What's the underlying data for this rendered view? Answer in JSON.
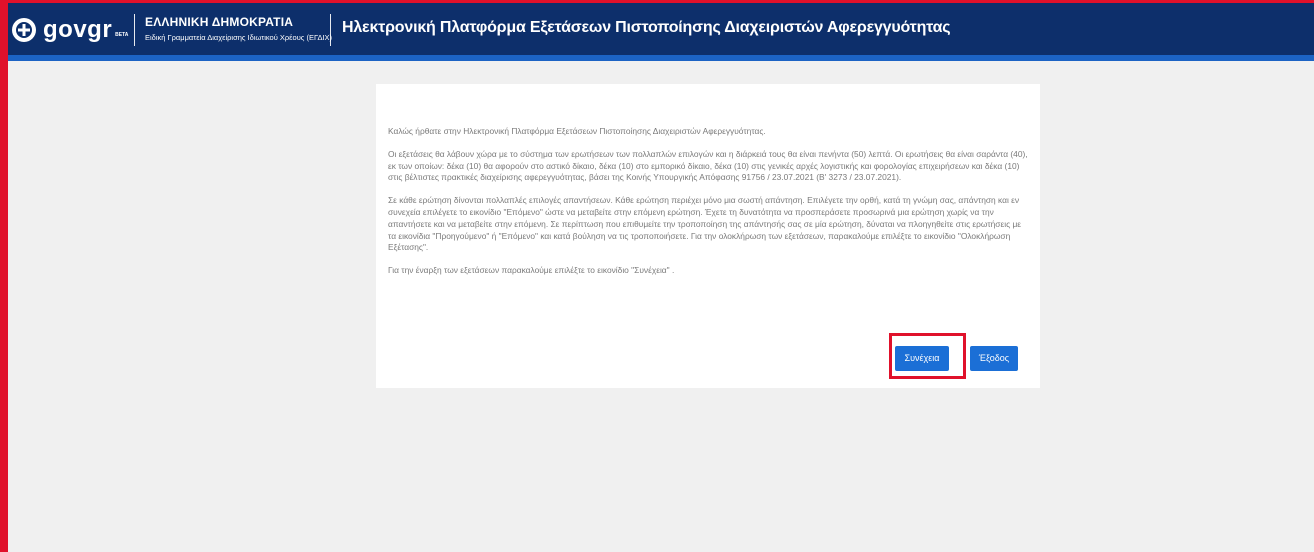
{
  "header": {
    "logo_text": "govgr",
    "logo_badge": "BETA",
    "gov_title": "ΕΛΛΗΝΙΚΗ ΔΗΜΟΚΡΑΤΙΑ",
    "gov_subtitle": "Ειδική Γραμματεία Διαχείρισης Ιδιωτικού Χρέους (ΕΓΔΙΧ)",
    "platform_title": "Ηλεκτρονική Πλατφόρμα Εξετάσεων Πιστοποίησης Διαχειριστών Αφερεγγυότητας",
    "colors": {
      "bar": "#0d2f6b",
      "accent": "#1c63c4"
    },
    "icons": {
      "emblem": "greek-emblem-icon"
    }
  },
  "content": {
    "welcome": "Καλώς ήρθατε στην Ηλεκτρονική Πλατφόρμα Εξετάσεων Πιστοποίησης Διαχειριστών Αφερεγγυότητας.",
    "exam_info": "Οι εξετάσεις θα λάβουν χώρα με το σύστημα των ερωτήσεων των πολλαπλών επιλογών και η διάρκειά τους θα είναι πενήντα (50) λεπτά. Οι ερωτήσεις θα είναι σαράντα (40), εκ των οποίων: δέκα (10) θα αφορούν στο αστικό δίκαιο, δέκα (10) στο εμπορικό δίκαιο, δέκα (10) στις γενικές αρχές λογιστικής και φορολογίας επιχειρήσεων και δέκα (10) στις βέλτιστες πρακτικές διαχείρισης αφερεγγυότητας, βάσει της Κοινής Υπουργικής Απόφασης 91756 / 23.07.2021 (Β' 3273 / 23.07.2021).",
    "instructions": "Σε κάθε ερώτηση δίνονται πολλαπλές επιλογές απαντήσεων. Κάθε ερώτηση περιέχει μόνο μια σωστή απάντηση. Επιλέγετε την ορθή, κατά τη γνώμη σας, απάντηση και εν συνεχεία επιλέγετε το εικονίδιο \"Επόμενο\" ώστε να μεταβείτε στην επόμενη ερώτηση. Έχετε τη δυνατότητα να προσπεράσετε προσωρινά μια ερώτηση χωρίς να την απαντήσετε και να μεταβείτε στην επόμενη. Σε περίπτωση που επιθυμείτε την τροποποίηση της απάντησής σας σε μία ερώτηση, δύναται να πλοηγηθείτε στις ερωτήσεις με τα εικονίδια \"Προηγούμενο\" ή \"Επόμενο\" και κατά βούληση να τις τροποποιήσετε. Για την ολοκλήρωση των εξετάσεων, παρακαλούμε επιλέξτε το εικονίδιο \"Ολοκλήρωση Εξέτασης\".",
    "start_prompt": "Για την έναρξη των εξετάσεων παρακαλούμε επιλέξτε το εικονίδιο \"Συνέχεια\" ."
  },
  "buttons": {
    "continue": "Συνέχεια",
    "exit": "Έξοδος",
    "color": "#1b6fd6"
  },
  "highlight_color": "#e0112b"
}
